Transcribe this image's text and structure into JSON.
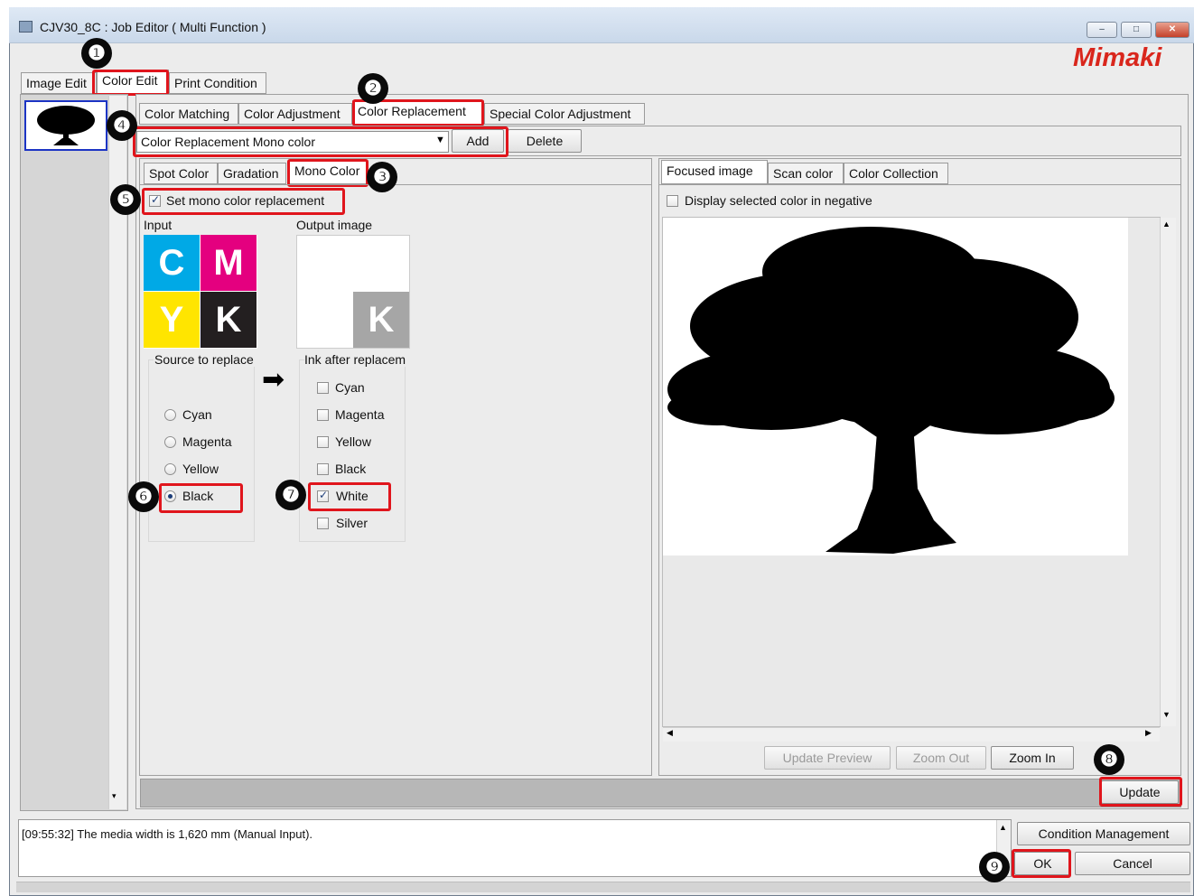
{
  "window": {
    "title": "CJV30_8C : Job Editor ( Multi Function )",
    "logo": "Mimaki",
    "controls": [
      "–",
      "□",
      "✕"
    ]
  },
  "main_tabs": [
    "Image Edit",
    "Color Edit",
    "Print Condition"
  ],
  "sub_tabs": [
    "Color Matching",
    "Color Adjustment",
    "Color Replacement",
    "Special Color Adjustment"
  ],
  "replacement_selector": {
    "value": "Color Replacement Mono color",
    "add_label": "Add",
    "delete_label": "Delete"
  },
  "mode_tabs": [
    "Spot Color",
    "Gradation",
    "Mono Color"
  ],
  "mono": {
    "set_label": "Set mono color replacement",
    "input_label": "Input",
    "output_label": "Output image",
    "cmyk": [
      "C",
      "M",
      "Y",
      "K"
    ],
    "output_letter": "K",
    "source_title": "Source to replace",
    "source_options": [
      "Cyan",
      "Magenta",
      "Yellow",
      "Black"
    ],
    "source_selected": "Black",
    "ink_title": "Ink after replacem",
    "ink_options": [
      "Cyan",
      "Magenta",
      "Yellow",
      "Black",
      "White",
      "Silver"
    ],
    "ink_checked": [
      "White"
    ],
    "arrow": "➡"
  },
  "preview": {
    "tabs": [
      "Focused image",
      "Scan color",
      "Color Collection"
    ],
    "negative_label": "Display selected color in negative",
    "update_preview_label": "Update Preview",
    "zoom_out_label": "Zoom Out",
    "zoom_in_label": "Zoom In"
  },
  "update_label": "Update",
  "log": {
    "message": "[09:55:32] The media width is 1,620 mm (Manual Input)."
  },
  "footer": {
    "condition_management_label": "Condition Management",
    "ok_label": "OK",
    "cancel_label": "Cancel"
  },
  "callouts": [
    "❶",
    "❷",
    "❸",
    "❹",
    "❺",
    "❻",
    "❼",
    "❽",
    "❾"
  ],
  "colors": {
    "highlight": "#e0151c",
    "cyan": "#00a9e6",
    "magenta": "#e4007f",
    "yellow": "#ffe500",
    "black": "#231f20",
    "logo_red": "#d9261c"
  }
}
